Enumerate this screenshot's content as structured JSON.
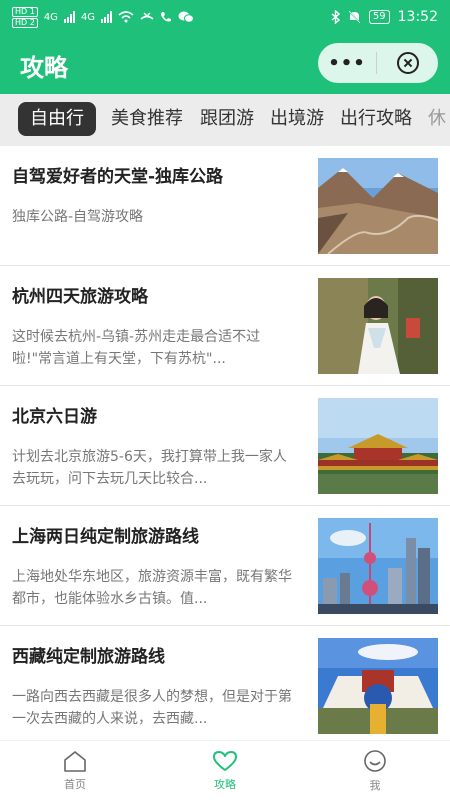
{
  "statusbar": {
    "hd1": "HD 1",
    "hd2": "HD 2",
    "net1": "4G",
    "net2": "4G",
    "battery": "59",
    "time": "13:52",
    "icons": [
      "signal-icon",
      "wifi-icon",
      "missed-call-icon",
      "phone-icon",
      "wechat-icon",
      "bluetooth-icon",
      "mute-bell-icon",
      "battery-icon"
    ]
  },
  "header": {
    "title": "攻略",
    "more_label": "•••"
  },
  "tabs": [
    {
      "label": "自由行",
      "active": true
    },
    {
      "label": "美食推荐",
      "active": false
    },
    {
      "label": "跟团游",
      "active": false
    },
    {
      "label": "出境游",
      "active": false
    },
    {
      "label": "出行攻略",
      "active": false
    },
    {
      "label": "休",
      "active": false
    }
  ],
  "articles": [
    {
      "title": "自驾爱好者的天堂-独库公路",
      "desc": "独库公路-自驾游攻略",
      "thumb": "mountain-road-image"
    },
    {
      "title": "杭州四天旅游攻略",
      "desc": "这时候去杭州-乌镇-苏州走走最合适不过啦!\"常言道上有天堂，下有苏杭\"...",
      "thumb": "hanfu-girl-image"
    },
    {
      "title": "北京六日游",
      "desc": "计划去北京旅游5-6天，我打算带上我一家人去玩玩，问下去玩几天比较合...",
      "thumb": "forbidden-city-image"
    },
    {
      "title": "上海两日纯定制旅游路线",
      "desc": "上海地处华东地区，旅游资源丰富，既有繁华都市，也能体验水乡古镇。值...",
      "thumb": "shanghai-skyline-image"
    },
    {
      "title": "西藏纯定制旅游路线",
      "desc": "一路向西去西藏是很多人的梦想，但是对于第一次去西藏的人来说，去西藏...",
      "thumb": "potala-palace-image"
    }
  ],
  "bottom_nav": [
    {
      "label": "首页",
      "icon": "home-icon",
      "active": false
    },
    {
      "label": "攻略",
      "icon": "heart-icon",
      "active": true
    },
    {
      "label": "我",
      "icon": "smile-icon",
      "active": false
    }
  ],
  "colors": {
    "brand": "#1fc17a",
    "tab_active_bg": "#333333",
    "tabs_bg": "#ececec"
  }
}
